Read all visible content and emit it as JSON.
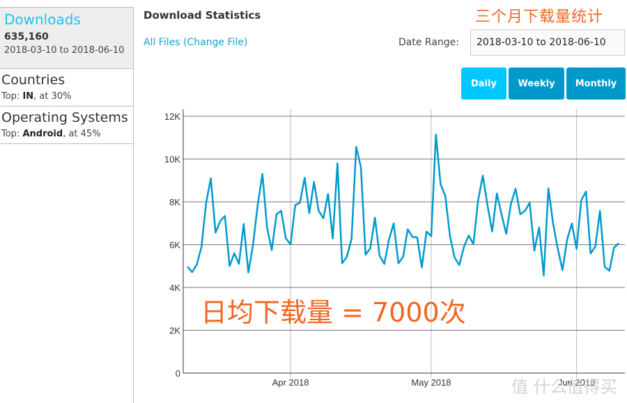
{
  "sidebar": {
    "downloads": {
      "title": "Downloads",
      "count": "635,160",
      "range": "2018-03-10 to 2018-06-10"
    },
    "countries": {
      "title": "Countries",
      "prefix": "Top: ",
      "top": "IN",
      "suffix": ", at 30%"
    },
    "os": {
      "title": "Operating Systems",
      "prefix": "Top: ",
      "top": "Android",
      "suffix": ", at 45%"
    }
  },
  "header": {
    "title": "Download Statistics",
    "file_link": "All Files (Change File)",
    "date_label": "Date Range:",
    "date_value": "2018-03-10 to 2018-06-10"
  },
  "buttons": {
    "daily": "Daily",
    "weekly": "Weekly",
    "monthly": "Monthly"
  },
  "annotations": {
    "top": "三个月下载量统计",
    "middle": "日均下载量 = 7000次"
  },
  "watermark": "值 什么值得买",
  "colors": {
    "line": "#0099cc",
    "accent": "#1ec2f2",
    "annotation": "#f26522",
    "active_button": "#00c8ff"
  },
  "chart_data": {
    "type": "line",
    "x_start": "2018-03-10",
    "x_end": "2018-06-10",
    "x_interval": "daily",
    "ylim": [
      0,
      12000
    ],
    "y_ticks": [
      0,
      2000,
      4000,
      6000,
      8000,
      10000,
      12000
    ],
    "y_tick_labels": [
      "0",
      "2K",
      "4K",
      "6K",
      "8K",
      "10K",
      "12K"
    ],
    "x_ticks": [
      "2018-04-01",
      "2018-05-01",
      "2018-06-01"
    ],
    "x_tick_labels": [
      "Apr 2018",
      "May 2018",
      "Jun 2018"
    ],
    "grid": true,
    "series": [
      {
        "values": [
          4970,
          4720,
          5070,
          5900,
          7960,
          9100,
          6560,
          7100,
          7340,
          5000,
          5600,
          5100,
          6970,
          4700,
          6000,
          7850,
          9300,
          6770,
          5750,
          7420,
          7580,
          6290,
          6020,
          7850,
          7960,
          9130,
          7470,
          8930,
          7580,
          7230,
          8370,
          6290,
          9800,
          5130,
          5430,
          6260,
          10570,
          9630,
          5530,
          5830,
          7260,
          5480,
          5100,
          6240,
          6990,
          5130,
          5430,
          6720,
          6360,
          6340,
          4940,
          6610,
          6400,
          11140,
          8820,
          8280,
          6400,
          5390,
          5050,
          5910,
          6430,
          6020,
          8070,
          9230,
          7850,
          6610,
          8390,
          7420,
          6500,
          7910,
          8610,
          7420,
          7580,
          7960,
          5720,
          6800,
          4560,
          8630,
          6990,
          5800,
          4810,
          6240,
          6990,
          5800,
          8070,
          8480,
          5590,
          5910,
          7580,
          4960,
          4780,
          5860,
          6070
        ]
      }
    ]
  }
}
